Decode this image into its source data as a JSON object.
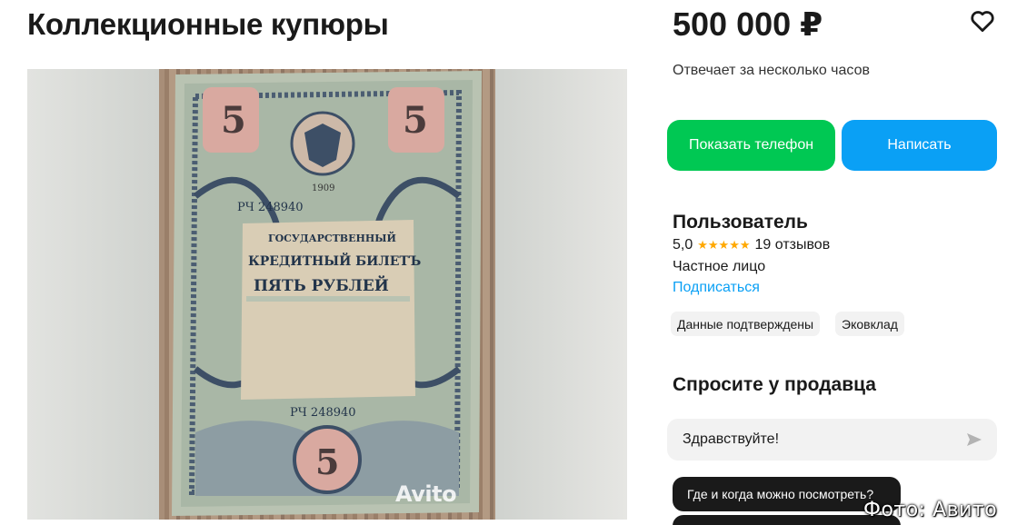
{
  "listing": {
    "title": "Коллекционные купюры",
    "price": "500 000 ₽",
    "response_time": "Отвечает за несколько часов"
  },
  "actions": {
    "show_phone": "Показать телефон",
    "write": "Написать"
  },
  "seller": {
    "name": "Пользователь",
    "rating": "5,0",
    "stars": "★★★★★",
    "reviews": "19 отзывов",
    "type": "Частное лицо",
    "subscribe": "Подписаться",
    "badges": [
      "Данные подтверждены",
      "Эковклад"
    ]
  },
  "ask": {
    "title": "Спросите у продавца",
    "input_value": "Здравствуйте!",
    "quick_questions": [
      "Где и когда можно посмотреть?",
      ""
    ]
  },
  "banknote": {
    "denomination": "5",
    "year": "1909",
    "serial": "РЧ 248940",
    "header": "ГОСУДАРСТВЕННЫЙ",
    "subheader": "КРЕДИТНЫЙ БИЛЕТЪ",
    "value_text": "ПЯТЬ РУБЛЕЙ"
  },
  "photo_watermark": "Avito",
  "photo_credit": "Фото: Авито",
  "colors": {
    "green": "#00c853",
    "blue": "#0aa0f5",
    "star": "#ffa800",
    "dark": "#1a1a1a"
  },
  "icons": [
    "heart-icon",
    "send-icon",
    "star-icon",
    "eagle-emblem"
  ]
}
